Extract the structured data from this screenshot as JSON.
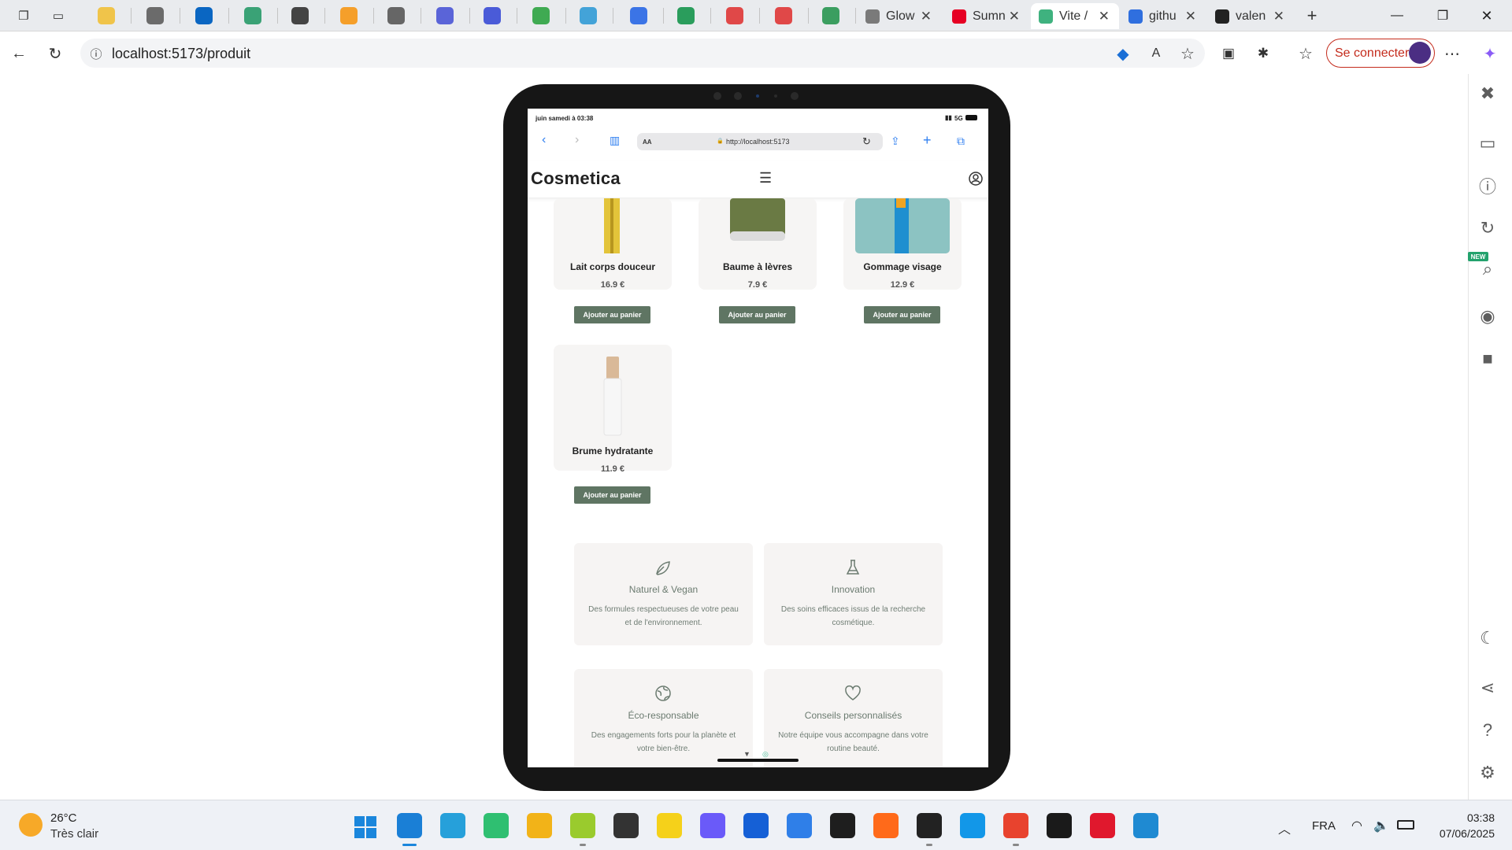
{
  "browser": {
    "tabs": [
      {
        "title": "Glow",
        "favicon_color": "#7a7a7a"
      },
      {
        "title": "Sumn",
        "favicon_color": "#e60023"
      },
      {
        "title": "Vite /",
        "favicon_color": "#3fb27f",
        "active": true
      },
      {
        "title": "githu",
        "favicon_color": "#2f6fdf"
      },
      {
        "title": "valen",
        "favicon_color": "#222222"
      }
    ],
    "pinned_tab_colors": [
      "#f0c44a",
      "#6b6b6b",
      "#0a66c2",
      "#3aa276",
      "#444444",
      "#f59f2a",
      "#666666",
      "#5a64d8",
      "#4a5bd8",
      "#3faa52",
      "#43a3d8",
      "#3b74e6",
      "#2a9d5c",
      "#e04848",
      "#e04848",
      "#3b9e60"
    ],
    "url": "localhost:5173/produit",
    "signin_label": "Se connecter"
  },
  "device": {
    "status_time": "juin samedi à 03:38",
    "network": "5G",
    "safari_text_size": "AA",
    "safari_url": "http://localhost:5173"
  },
  "app": {
    "logo": "Cosmetica",
    "products": [
      {
        "name": "Lait corps douceur",
        "price": "16.9 €",
        "button": "Ajouter au panier"
      },
      {
        "name": "Baume à lèvres",
        "price": "7.9 €",
        "button": "Ajouter au panier"
      },
      {
        "name": "Gommage visage",
        "price": "12.9 €",
        "button": "Ajouter au panier"
      },
      {
        "name": "Brume hydratante",
        "price": "11.9 €",
        "button": "Ajouter au panier"
      }
    ],
    "features": [
      {
        "title": "Naturel & Vegan",
        "desc": "Des formules respectueuses de votre peau et de l'environnement.",
        "icon": "leaf-icon"
      },
      {
        "title": "Innovation",
        "desc": "Des soins efficaces issus de la recherche cosmétique.",
        "icon": "flask-icon"
      },
      {
        "title": "Éco-responsable",
        "desc": "Des engagements forts pour la planète et votre bien-être.",
        "icon": "globe-icon"
      },
      {
        "title": "Conseils personnalisés",
        "desc": "Notre équipe vous accompagne dans votre routine beauté.",
        "icon": "heart-icon"
      }
    ]
  },
  "sidebar_icons": [
    "close-icon",
    "devices-icon",
    "info-icon",
    "rotate-icon",
    "zoom-icon",
    "screenshot-icon",
    "record-icon",
    "dark-mode-icon",
    "share-icon",
    "help-icon",
    "settings-icon"
  ],
  "sidebar_badge": "NEW",
  "taskbar": {
    "weather_temp": "26°C",
    "weather_desc": "Très clair",
    "language": "FRA",
    "time": "03:38",
    "date": "07/06/2025",
    "app_colors": [
      "#1a7fd6",
      "#26a0da",
      "#2fbf71",
      "#f2b318",
      "#9acb2d",
      "#333333",
      "#f5d11a",
      "#6a5af9",
      "#1560d6",
      "#2f7fe8",
      "#1e1e1e",
      "#ff6a1a",
      "#222222",
      "#1297e8",
      "#e8432e",
      "#1a1a1a",
      "#e0182d",
      "#1f8ad2"
    ]
  }
}
